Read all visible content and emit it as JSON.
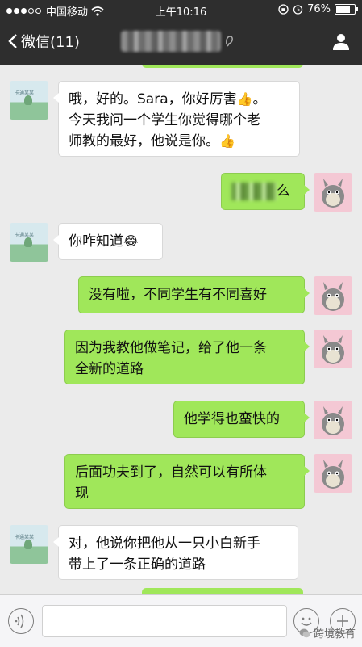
{
  "status_bar": {
    "carrier": "中国移动",
    "time": "上午10:16",
    "battery": "76%"
  },
  "nav": {
    "back_label": "微信(11)"
  },
  "messages": [
    {
      "side": "left",
      "lines": [
        "哦，好的。Sara，你好厉害",
        "今天我问一个学生你觉得哪个老",
        "师教的最好，他说是你。"
      ]
    },
    {
      "side": "right",
      "text": "么"
    },
    {
      "side": "left",
      "text": "你咋知道"
    },
    {
      "side": "right",
      "text": "没有啦，不同学生有不同喜好"
    },
    {
      "side": "right",
      "lines": [
        "因为我教他做笔记，给了他一条",
        "全新的道路"
      ]
    },
    {
      "side": "right",
      "text": "他学得也蛮快的"
    },
    {
      "side": "right",
      "lines": [
        "后面功夫到了，自然可以有所体",
        "现"
      ]
    },
    {
      "side": "left",
      "lines": [
        "对，他说你把他从一只小白新手",
        "带上了一条正确的道路"
      ]
    }
  ],
  "emoji": {
    "thumbs_up": "👍",
    "laugh": "😂"
  },
  "watermark": "跨境教育",
  "colors": {
    "bar": "#2e2e2e",
    "bubble_green": "#a0e75a",
    "bubble_white": "#ffffff",
    "background": "#ebebeb"
  }
}
